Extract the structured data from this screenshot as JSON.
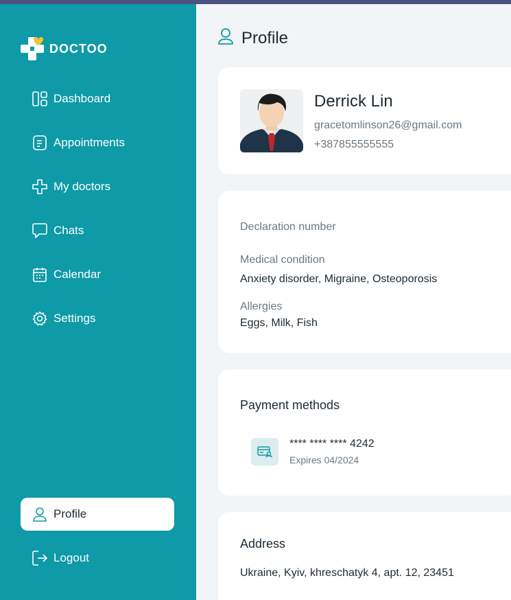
{
  "brand": {
    "name": "DOCTOO"
  },
  "sidebar": {
    "items": [
      {
        "label": "Dashboard",
        "icon": "dashboard-icon"
      },
      {
        "label": "Appointments",
        "icon": "appointments-icon"
      },
      {
        "label": "My doctors",
        "icon": "medical-cross-icon"
      },
      {
        "label": "Chats",
        "icon": "chat-bubble-icon"
      },
      {
        "label": "Calendar",
        "icon": "calendar-icon"
      },
      {
        "label": "Settings",
        "icon": "gear-icon"
      }
    ],
    "profile": {
      "label": "Profile",
      "icon": "user-icon"
    },
    "logout": {
      "label": "Logout",
      "icon": "logout-icon"
    }
  },
  "page": {
    "title": "Profile",
    "icon": "user-icon"
  },
  "profile": {
    "name": "Derrick Lin",
    "email": "gracetomlinson26@gmail.com",
    "phone": "+387855555555"
  },
  "medical": {
    "declaration_label": "Declaration number",
    "condition_label": "Medical condition",
    "condition_value": "Anxiety disorder, Migraine, Osteoporosis",
    "allergies_label": "Allergies",
    "allergies_value": "Eggs, Milk, Fish"
  },
  "payment": {
    "title": "Payment methods",
    "card_number": "**** **** **** 4242",
    "expires": "Expires 04/2024"
  },
  "address": {
    "title": "Address",
    "value": "Ukraine, Kyiv, khreschatyk 4, apt. 12, 23451"
  },
  "colors": {
    "sidebar": "#0e9aa7",
    "topbar": "#4b5281",
    "background": "#f1f5f7"
  }
}
